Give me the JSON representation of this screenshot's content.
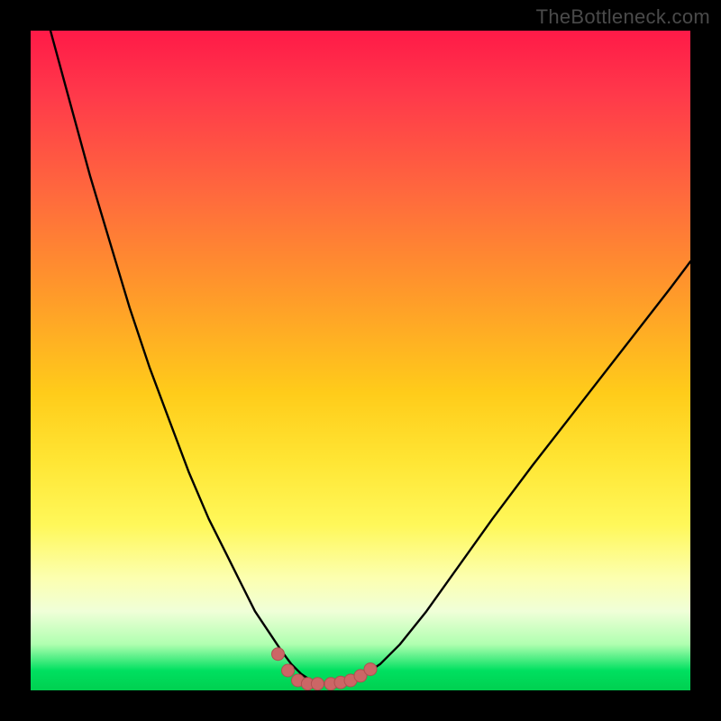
{
  "watermark": "TheBottleneck.com",
  "colors": {
    "curve_stroke": "#000000",
    "marker_fill": "#cc6666",
    "marker_stroke": "#b05050"
  },
  "chart_data": {
    "type": "line",
    "title": "",
    "xlabel": "",
    "ylabel": "",
    "xlim": [
      0,
      100
    ],
    "ylim": [
      0,
      100
    ],
    "series": [
      {
        "name": "bottleneck-curve",
        "x": [
          0,
          3,
          6,
          9,
          12,
          15,
          18,
          21,
          24,
          27,
          30,
          32,
          34,
          36,
          38,
          39.5,
          41,
          42.5,
          44,
          46,
          48,
          50,
          53,
          56,
          60,
          65,
          70,
          76,
          83,
          90,
          97,
          100
        ],
        "values": [
          112,
          100,
          89,
          78,
          68,
          58,
          49,
          41,
          33,
          26,
          20,
          16,
          12,
          9,
          6,
          4,
          2.5,
          1.5,
          1,
          1,
          1.2,
          2,
          4,
          7,
          12,
          19,
          26,
          34,
          43,
          52,
          61,
          65
        ]
      }
    ],
    "markers": {
      "name": "bottom-dots",
      "x": [
        37.5,
        39,
        40.5,
        42,
        43.5,
        45.5,
        47,
        48.5,
        50,
        51.5
      ],
      "values": [
        5.5,
        3,
        1.5,
        1,
        1,
        1,
        1.2,
        1.5,
        2.2,
        3.2
      ]
    }
  }
}
